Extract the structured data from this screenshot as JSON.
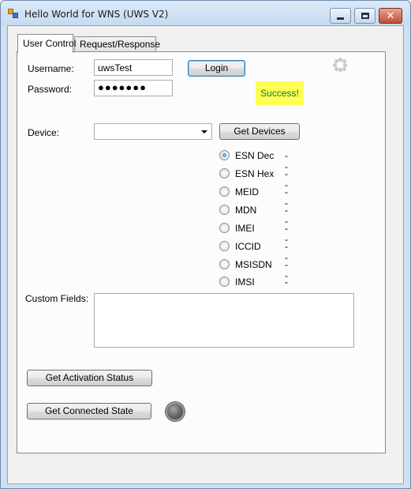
{
  "window": {
    "title": "Hello World for WNS (UWS V2)",
    "close_glyph": "✕"
  },
  "tabs": [
    {
      "label": "User Control",
      "active": true
    },
    {
      "label": "Request/Response",
      "active": false
    }
  ],
  "login": {
    "username_label": "Username:",
    "username_value": "uwsTest",
    "password_label": "Password:",
    "password_value": "●●●●●●●",
    "login_button": "Login",
    "status_text": "Success!",
    "status_bg": "#ffff55",
    "status_color": "#0a7a3a"
  },
  "device": {
    "label": "Device:",
    "selected": "",
    "get_devices_button": "Get Devices"
  },
  "identifiers": [
    {
      "label": "ESN Dec",
      "value": "--",
      "selected": true
    },
    {
      "label": "ESN Hex",
      "value": "--",
      "selected": false
    },
    {
      "label": "MEID",
      "value": "--",
      "selected": false
    },
    {
      "label": "MDN",
      "value": "--",
      "selected": false
    },
    {
      "label": "IMEI",
      "value": "--",
      "selected": false
    },
    {
      "label": "ICCID",
      "value": "--",
      "selected": false
    },
    {
      "label": "MSISDN",
      "value": "--",
      "selected": false
    },
    {
      "label": "IMSI",
      "value": "--",
      "selected": false
    }
  ],
  "custom_fields": {
    "label": "Custom Fields:",
    "value": ""
  },
  "actions": {
    "activation_button": "Get Activation Status",
    "connected_button": "Get Connected State",
    "indicator_state": "off"
  },
  "icons": {
    "app": "app-icon",
    "spinner": "loading-spinner-icon",
    "indicator": "status-led-icon"
  }
}
